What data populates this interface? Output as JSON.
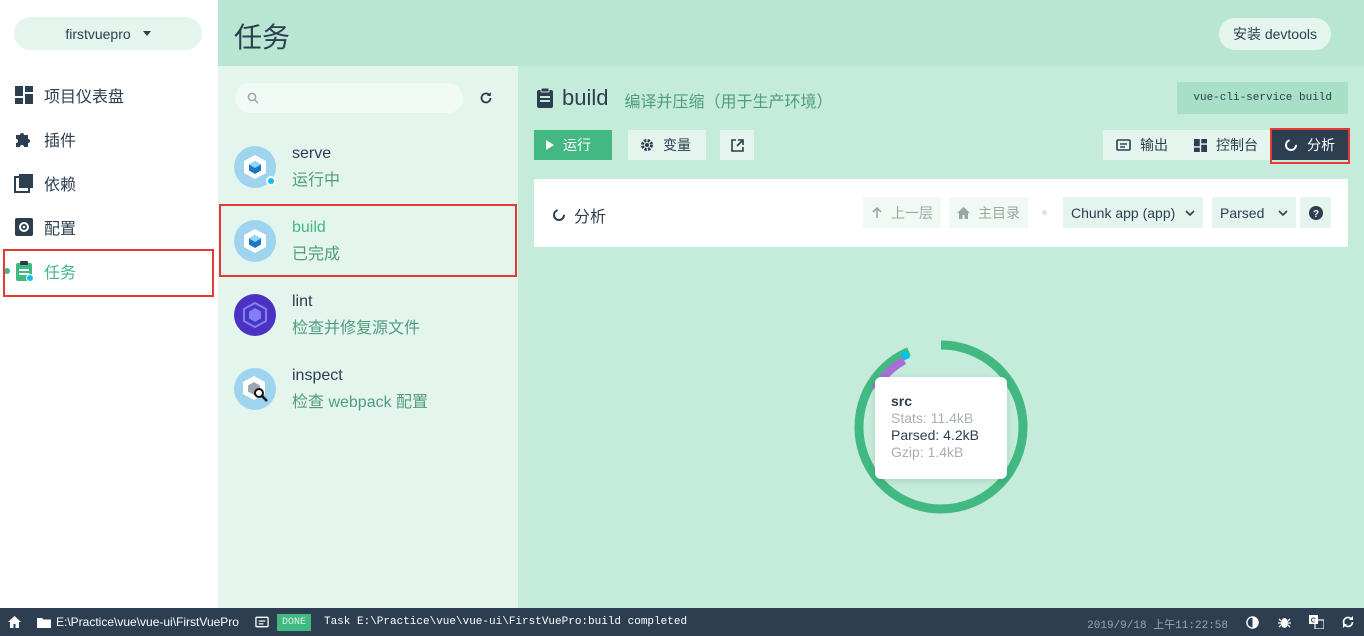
{
  "nav": {
    "project": "firstvuepro",
    "items": [
      {
        "label": "项目仪表盘",
        "icon": "dashboard-icon"
      },
      {
        "label": "插件",
        "icon": "puzzle-icon"
      },
      {
        "label": "依赖",
        "icon": "library-icon"
      },
      {
        "label": "配置",
        "icon": "settings-icon"
      },
      {
        "label": "任务",
        "icon": "clipboard-icon",
        "active": true
      }
    ]
  },
  "header": {
    "title": "任务",
    "devtools_label": "安装 devtools"
  },
  "tasks": {
    "search_placeholder": "",
    "items": [
      {
        "name": "serve",
        "desc": "运行中",
        "icon": "webpack-icon",
        "running": true
      },
      {
        "name": "build",
        "desc": "已完成",
        "icon": "webpack-icon",
        "selected": true
      },
      {
        "name": "lint",
        "desc": "检查并修复源文件",
        "icon": "eslint-icon"
      },
      {
        "name": "inspect",
        "desc": "检查 webpack 配置",
        "icon": "webpack-inspect-icon"
      }
    ]
  },
  "detail": {
    "name": "build",
    "desc": "编译并压缩（用于生产环境）",
    "command": "vue-cli-service build",
    "run_label": "运行",
    "vars_label": "变量",
    "views": [
      {
        "label": "输出",
        "icon": "output-icon"
      },
      {
        "label": "控制台",
        "icon": "dashboard-icon"
      },
      {
        "label": "分析",
        "icon": "analysis-icon",
        "active": true
      }
    ],
    "panel": {
      "title": "分析",
      "up_label": "上一层",
      "root_label": "主目录",
      "chunk_select": "Chunk app (app)",
      "size_select": "Parsed"
    },
    "tooltip": {
      "name": "src",
      "stats": "Stats: 11.4kB",
      "parsed": "Parsed: 4.2kB",
      "gzip": "Gzip: 1.4kB"
    },
    "chart_colors": {
      "main": "#42b983",
      "purple": "#a86fd6",
      "cyan": "#03c2e6"
    }
  },
  "status": {
    "path": "E:\\Practice\\vue\\vue-ui\\FirstVuePro",
    "badge": "DONE",
    "message": "Task E:\\Practice\\vue\\vue-ui\\FirstVuePro:build completed",
    "time": "2019/9/18 上午11:22:58"
  }
}
